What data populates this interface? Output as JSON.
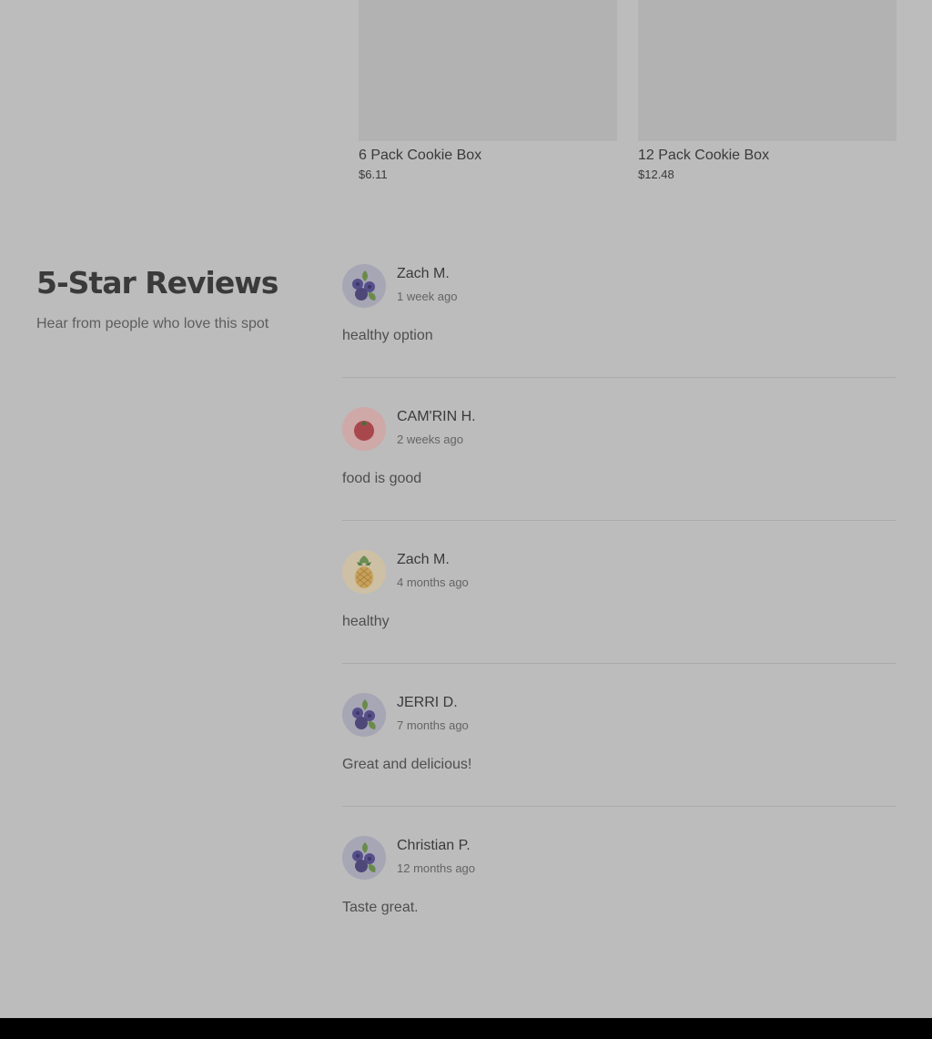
{
  "products": [
    {
      "name": "6 Pack Cookie Box",
      "price": "$6.11"
    },
    {
      "name": "12 Pack Cookie Box",
      "price": "$12.48"
    }
  ],
  "reviews_section": {
    "title": "5-Star Reviews",
    "subtitle": "Hear from people who love this spot",
    "reviews": [
      {
        "name": "Zach M.",
        "date": "1 week ago",
        "text": "healthy option",
        "avatar_icon": "blueberry-icon",
        "avatar_bg": "#a6a6b5"
      },
      {
        "name": "CAM'RIN H.",
        "date": "2 weeks ago",
        "text": "food is good",
        "avatar_icon": "tomato-icon",
        "avatar_bg": "#cfa8a8"
      },
      {
        "name": "Zach M.",
        "date": "4 months ago",
        "text": "healthy",
        "avatar_icon": "pineapple-icon",
        "avatar_bg": "#cdc0a4"
      },
      {
        "name": "JERRI D.",
        "date": "7 months ago",
        "text": "Great and delicious!",
        "avatar_icon": "blueberry-icon",
        "avatar_bg": "#a6a6b5"
      },
      {
        "name": "Christian P.",
        "date": "12 months ago",
        "text": "Taste great.",
        "avatar_icon": "blueberry-icon",
        "avatar_bg": "#a6a6b5"
      }
    ]
  }
}
